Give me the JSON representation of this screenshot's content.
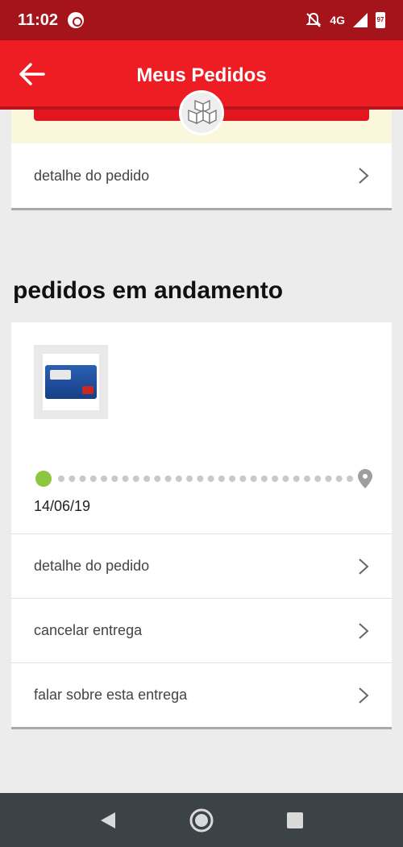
{
  "status_bar": {
    "time": "11:02",
    "network": "4G",
    "battery": "97"
  },
  "app_bar": {
    "title": "Meus Pedidos"
  },
  "previous_order": {
    "detail_label": "detalhe do pedido"
  },
  "section": {
    "title": "pedidos em andamento"
  },
  "order": {
    "product_image": "lacta-chocolate-box",
    "date": "14/06/19",
    "progress": 0.0,
    "actions": [
      {
        "label": "detalhe do pedido"
      },
      {
        "label": "cancelar entrega"
      },
      {
        "label": "falar sobre esta entrega"
      }
    ]
  },
  "colors": {
    "status_bar": "#a4141a",
    "app_bar": "#ee1c23",
    "progress_active": "#8dc63f",
    "progress_inactive": "#c9c9c9"
  },
  "nav": {
    "icons": [
      "back-triangle-icon",
      "home-circle-icon",
      "recents-square-icon"
    ]
  }
}
